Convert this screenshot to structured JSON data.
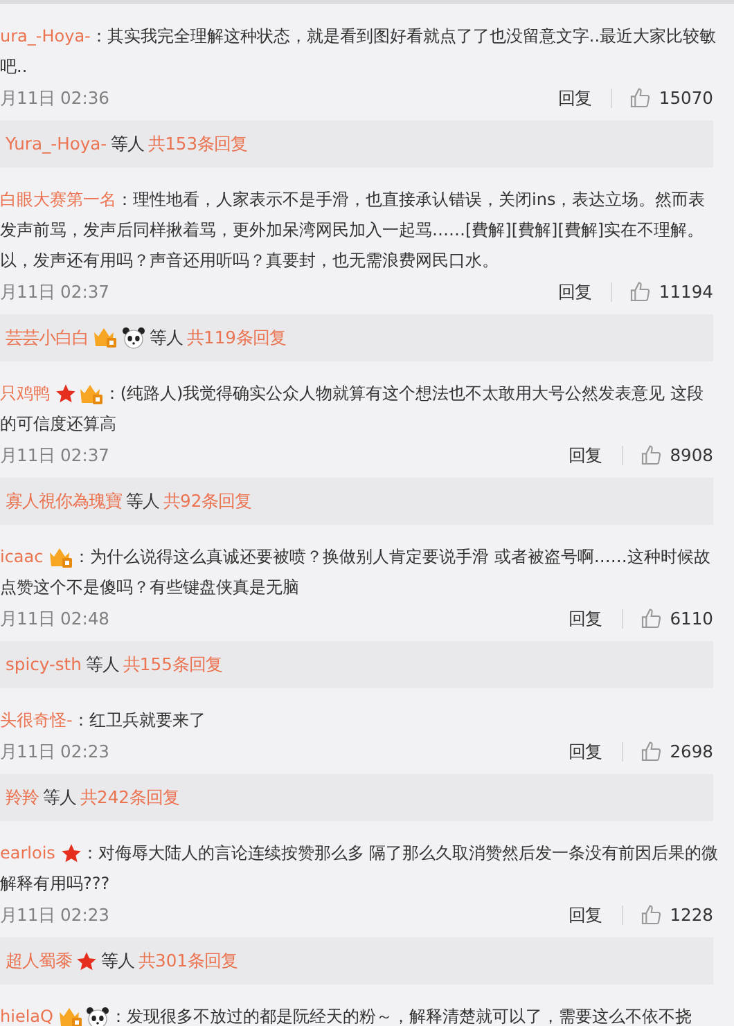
{
  "comments": [
    {
      "author": "ura_-Hoya-",
      "body": [
        "：其实我完全理解这种状态，就是看到图好看就点了了也没留意文字..最近大家比较敏",
        "吧.."
      ],
      "time": "月11日 02:36",
      "reply_label": "回复",
      "likes": "15070",
      "replies": {
        "user": "Yura_-Hoya-",
        "others": "等人",
        "count": "共153条回复"
      }
    },
    {
      "author": "白眼大赛第一名",
      "body": [
        "：理性地看，人家表示不是手滑，也直接承认错误，关闭ins，表达立场。然而表",
        "发声前骂，发声后同样揪着骂，更外加呆湾网民加入一起骂……[費解][費解][費解]实在不理解。",
        "以，发声还有用吗？声音还用听吗？真要封，也无需浪费网民口水。"
      ],
      "time": "月11日 02:37",
      "reply_label": "回复",
      "likes": "11194",
      "replies": {
        "user": "芸芸小白白",
        "badges": [
          {
            "kind": "vip"
          },
          {
            "kind": "panda"
          }
        ],
        "others": "等人",
        "count": "共119条回复"
      }
    },
    {
      "author": "只鸡鸭",
      "badges": [
        {
          "kind": "star"
        },
        {
          "kind": "vip"
        }
      ],
      "body": [
        "：(纯路人)我觉得确实公众人物就算有这个想法也不太敢用大号公然发表意见 这段",
        "的可信度还算高"
      ],
      "time": "月11日 02:37",
      "reply_label": "回复",
      "likes": "8908",
      "replies": {
        "user": "寡人視你為瑰寶",
        "others": "等人",
        "count": "共92条回复"
      }
    },
    {
      "author": "icaac",
      "badges": [
        {
          "kind": "vip"
        }
      ],
      "body": [
        "：为什么说得这么真诚还要被喷？换做别人肯定要说手滑 或者被盗号啊……这种时候故",
        "点赞这个不是傻吗？有些键盘侠真是无脑"
      ],
      "time": "月11日 02:48",
      "reply_label": "回复",
      "likes": "6110",
      "replies": {
        "user": "spicy-sth",
        "others": "等人",
        "count": "共155条回复"
      }
    },
    {
      "author": "头很奇怪-",
      "body": [
        "：红卫兵就要来了"
      ],
      "time": "月11日 02:23",
      "reply_label": "回复",
      "likes": "2698",
      "replies": {
        "user": "羚羚",
        "others": "等人",
        "count": "共242条回复"
      }
    },
    {
      "author": "earlois",
      "badges": [
        {
          "kind": "star"
        }
      ],
      "body": [
        "：对侮辱大陆人的言论连续按赞那么多 隔了那么久取消赞然后发一条没有前因后果的微",
        "解释有用吗???"
      ],
      "time": "月11日 02:23",
      "reply_label": "回复",
      "likes": "1228",
      "replies": {
        "user": "超人蜀黍",
        "badges": [
          {
            "kind": "star"
          }
        ],
        "others": "等人",
        "count": "共301条回复"
      }
    },
    {
      "author": "hielaQ",
      "badges": [
        {
          "kind": "vip"
        },
        {
          "kind": "panda"
        }
      ],
      "body": [
        "：发现很多不放过的都是阮经天的粉～，解释清楚就可以了，需要这么不依不挠"
      ]
    }
  ]
}
